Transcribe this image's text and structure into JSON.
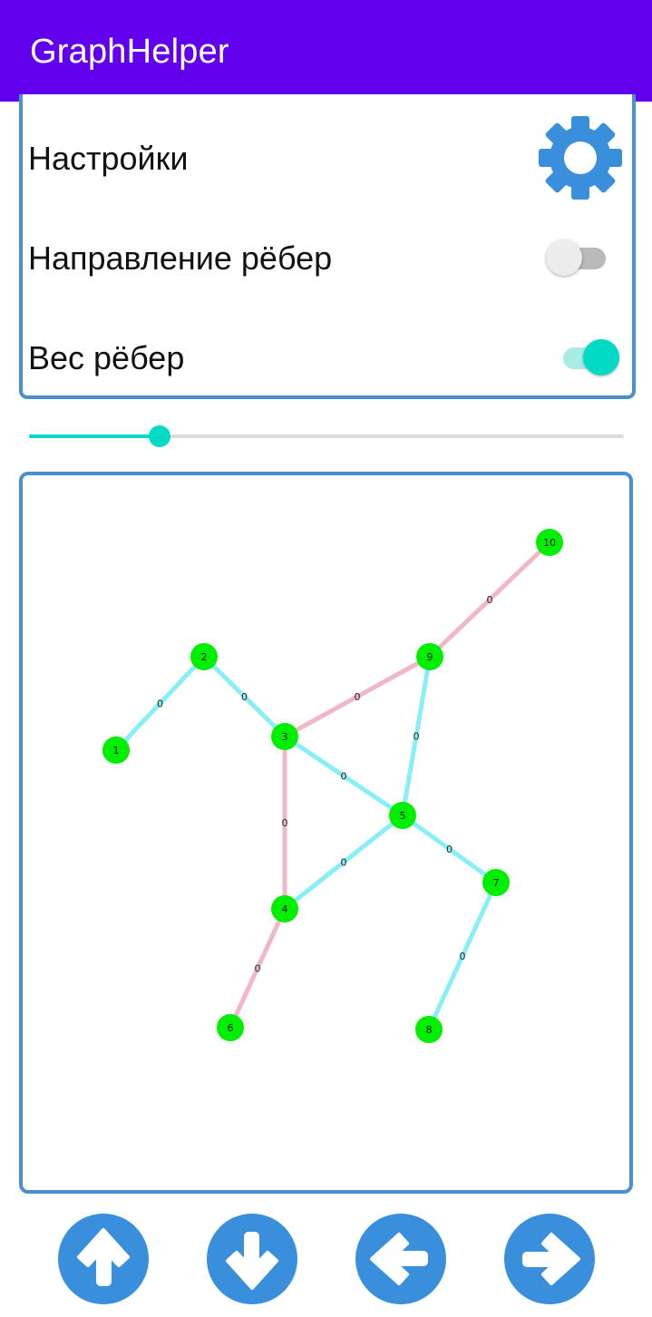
{
  "app": {
    "title": "GraphHelper"
  },
  "settings": {
    "title": "Настройки",
    "rows": [
      {
        "label": "Направление рёбер",
        "enabled": false
      },
      {
        "label": "Вес рёбер",
        "enabled": true
      }
    ]
  },
  "slider": {
    "value": 0.22
  },
  "colors": {
    "appbar": "#6200ee",
    "accent": "#03dac5",
    "border": "#4a90d0",
    "node": "#00ee00",
    "edge_cyan": "#87eff5",
    "edge_pink": "#f0b8c6",
    "button": "#3a8fdc"
  },
  "graph": {
    "nodes": [
      "1",
      "2",
      "3",
      "4",
      "5",
      "6",
      "7",
      "8",
      "9",
      "10"
    ],
    "edges": [
      {
        "from": "1",
        "to": "2",
        "weight": "0",
        "color": "cyan"
      },
      {
        "from": "2",
        "to": "3",
        "weight": "0",
        "color": "cyan"
      },
      {
        "from": "3",
        "to": "9",
        "weight": "0",
        "color": "pink"
      },
      {
        "from": "9",
        "to": "10",
        "weight": "0",
        "color": "pink"
      },
      {
        "from": "3",
        "to": "5",
        "weight": "0",
        "color": "cyan"
      },
      {
        "from": "3",
        "to": "4",
        "weight": "0",
        "color": "pink"
      },
      {
        "from": "9",
        "to": "5",
        "weight": "0",
        "color": "cyan"
      },
      {
        "from": "4",
        "to": "5",
        "weight": "0",
        "color": "cyan"
      },
      {
        "from": "5",
        "to": "7",
        "weight": "0",
        "color": "cyan"
      },
      {
        "from": "4",
        "to": "6",
        "weight": "0",
        "color": "pink"
      },
      {
        "from": "7",
        "to": "8",
        "weight": "0",
        "color": "cyan"
      }
    ]
  },
  "nav_buttons": [
    {
      "icon": "arrow-up-icon"
    },
    {
      "icon": "arrow-down-icon"
    },
    {
      "icon": "arrow-left-icon"
    },
    {
      "icon": "arrow-right-icon"
    }
  ]
}
